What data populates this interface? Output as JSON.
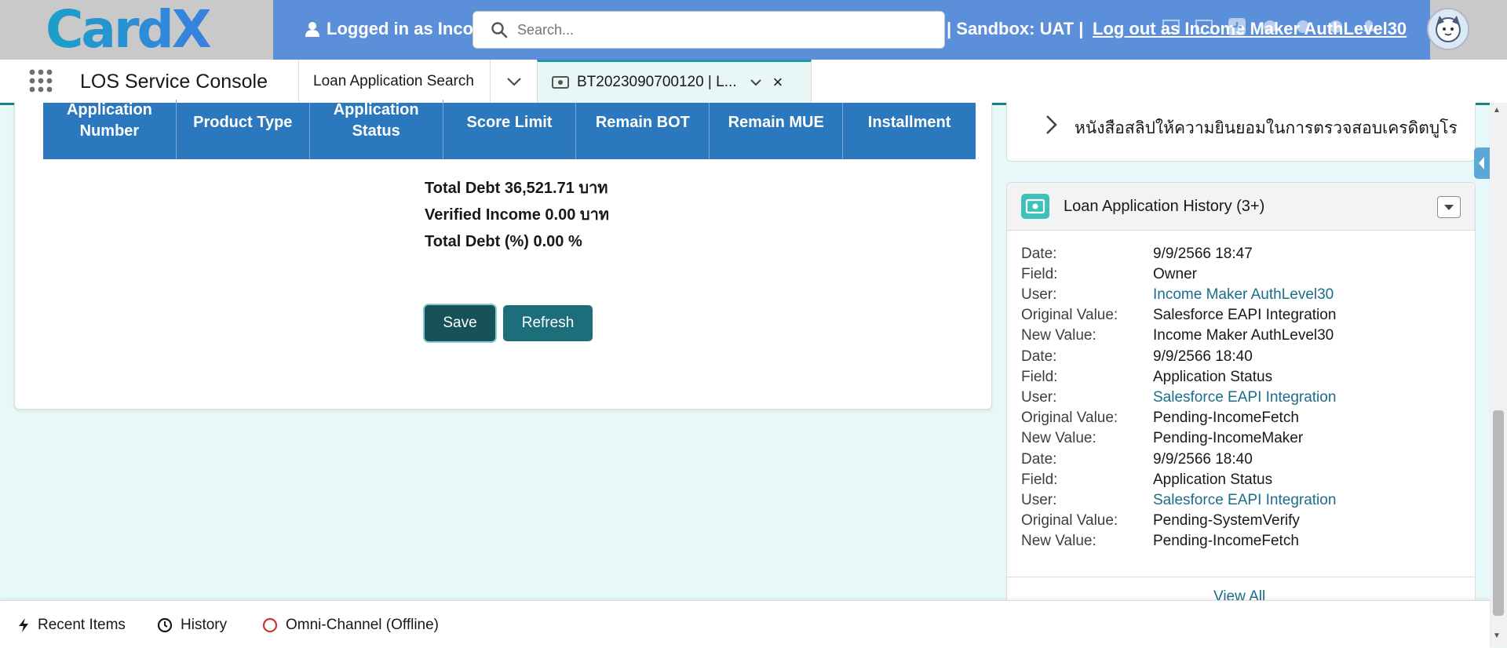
{
  "header": {
    "logo_text": "CardX",
    "logged_in_text": "Logged in as Inco",
    "search_placeholder": "Search...",
    "sandbox_text": "| Sandbox: UAT |",
    "logout_text": "Log out as Income Maker AuthLevel30",
    "accent_color": "#5b8fd9"
  },
  "nav": {
    "app_name": "LOS Service Console",
    "tabs": [
      {
        "label": "Loan Application Search"
      },
      {
        "label": "BT2023090700120 | L..."
      }
    ]
  },
  "table": {
    "headers": [
      "Application Number",
      "Product Type",
      "Application Status",
      "Score Limit",
      "Remain BOT",
      "Remain MUE",
      "Installment"
    ]
  },
  "totals": {
    "total_debt": "Total Debt 36,521.71 บาท",
    "verified_income": "Verified Income 0.00 บาท",
    "total_debt_pct": "Total Debt (%) 0.00 %"
  },
  "buttons": {
    "save": "Save",
    "refresh": "Refresh"
  },
  "consent": {
    "text": "หนังสือสลิปให้ความยินยอมในการตรวจสอบเครดิตบูโร"
  },
  "history": {
    "title": "Loan Application History (3+)",
    "labels": {
      "date": "Date:",
      "field": "Field:",
      "user": "User:",
      "original": "Original Value:",
      "new": "New Value:"
    },
    "entries": [
      {
        "date": "9/9/2566 18:47",
        "field": "Owner",
        "user": "Income Maker AuthLevel30",
        "original": "Salesforce EAPI Integration",
        "new": "Income Maker AuthLevel30"
      },
      {
        "date": "9/9/2566 18:40",
        "field": "Application Status",
        "user": "Salesforce EAPI Integration",
        "original": "Pending-IncomeFetch",
        "new": "Pending-IncomeMaker"
      },
      {
        "date": "9/9/2566 18:40",
        "field": "Application Status",
        "user": "Salesforce EAPI Integration",
        "original": "Pending-SystemVerify",
        "new": "Pending-IncomeFetch"
      }
    ],
    "view_all": "View All"
  },
  "utility": {
    "recent_items": "Recent Items",
    "history": "History",
    "omni_channel": "Omni-Channel (Offline)"
  }
}
